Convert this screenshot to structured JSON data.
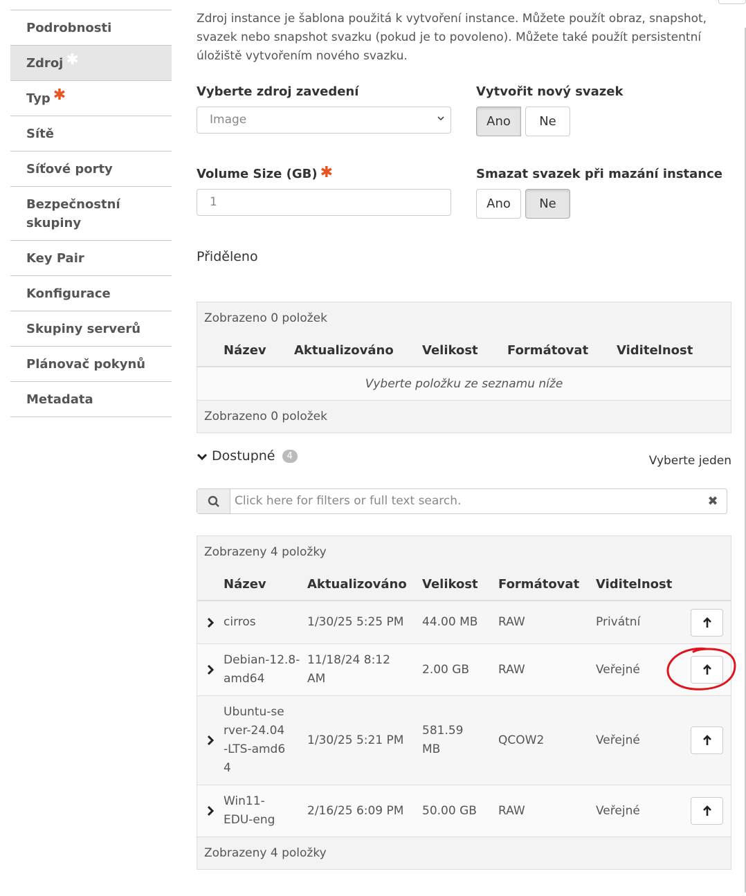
{
  "sidebar": {
    "items": [
      {
        "label": "Podrobnosti"
      },
      {
        "label": "Zdroj"
      },
      {
        "label": "Typ"
      },
      {
        "label": "Sítě"
      },
      {
        "label": "Síťové porty"
      },
      {
        "label": "Bezpečnostní skupiny"
      },
      {
        "label": "Key Pair"
      },
      {
        "label": "Konfigurace"
      },
      {
        "label": "Skupiny serverů"
      },
      {
        "label": "Plánovač pokynů"
      },
      {
        "label": "Metadata"
      }
    ],
    "required_mark": "✱"
  },
  "intro": "Zdroj instance je šablona použitá k vytvoření instance. Můžete použít obraz, snapshot, svazek nebo snapshot svazku (pokud je to povoleno). Můžete také použít persistentní úložiště vytvořením nového svazku.",
  "form": {
    "boot_source_label": "Vyberte zdroj zavedení",
    "boot_source_value": "Image",
    "new_volume_label": "Vytvořit nový svazek",
    "volume_size_label": "Volume Size (GB)",
    "volume_size_value": "1",
    "delete_volume_label": "Smazat svazek při mazání instance",
    "yes": "Ano",
    "no": "Ne",
    "new_volume_selected": "Ano",
    "delete_volume_selected": "Ne"
  },
  "allocated": {
    "title": "Přiděleno",
    "caption": "Zobrazeno 0 položek",
    "columns": [
      "Název",
      "Aktualizováno",
      "Velikost",
      "Formátovat",
      "Viditelnost"
    ],
    "empty_text": "Vyberte položku ze seznamu níže",
    "footer": "Zobrazeno 0 položek"
  },
  "available": {
    "title": "Dostupné",
    "count": "4",
    "select_one": "Vyberte jeden",
    "search_placeholder": "Click here for filters or full text search.",
    "caption": "Zobrazeny 4 položky",
    "columns": [
      "Název",
      "Aktualizováno",
      "Velikost",
      "Formátovat",
      "Viditelnost"
    ],
    "rows": [
      {
        "name": "cirros",
        "updated": "1/30/25 5:25 PM",
        "size": "44.00 MB",
        "format": "RAW",
        "visibility": "Privátní"
      },
      {
        "name": "Debian-12.8-amd64",
        "updated": "11/18/24 8:12 AM",
        "size": "2.00 GB",
        "format": "RAW",
        "visibility": "Veřejné"
      },
      {
        "name": "Ubuntu-server-24.04-LTS-amd64",
        "updated": "1/30/25 5:21 PM",
        "size": "581.59 MB",
        "format": "QCOW2",
        "visibility": "Veřejné"
      },
      {
        "name": "Win11-EDU-eng",
        "updated": "2/16/25 6:09 PM",
        "size": "50.00 GB",
        "format": "RAW",
        "visibility": "Veřejné"
      }
    ],
    "footer": "Zobrazeny 4 položky"
  },
  "colors": {
    "accent_required": "#e9531f",
    "annotation": "#e0141e"
  }
}
